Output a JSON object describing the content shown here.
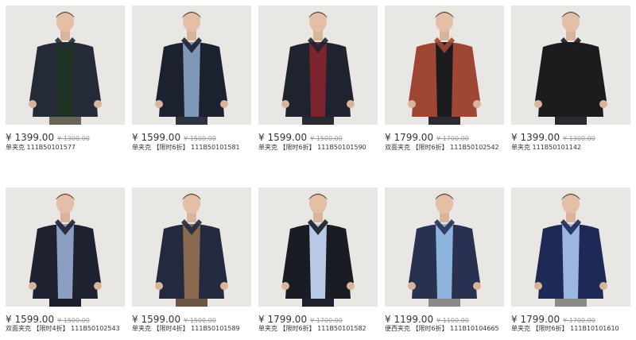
{
  "colors": {
    "photo_bg": "#e9e7e4",
    "text": "#333333",
    "strike": "#999999"
  },
  "products": [
    {
      "price": "¥ 1399.00",
      "old_price": "¥ 1300.00",
      "title": "单夹克 111B50101577",
      "image": {
        "icon": "jacket-model-photo",
        "jacket": "#252a37",
        "inner": "#1f3324",
        "pants": "#6b6558"
      }
    },
    {
      "price": "¥ 1599.00",
      "old_price": "¥ 1500.00",
      "title": "单夹克 【限时6折】 111B50101581",
      "image": {
        "icon": "jacket-model-photo",
        "jacket": "#1c2130",
        "inner": "#7f98b8",
        "pants": "#2d3140"
      }
    },
    {
      "price": "¥ 1599.00",
      "old_price": "¥ 1500.00",
      "title": "单夹克 【限时6折】 111B50101590",
      "image": {
        "icon": "jacket-model-photo",
        "jacket": "#1f232e",
        "inner": "#7b2430",
        "pants": "#2a2a30"
      }
    },
    {
      "price": "¥ 1799.00",
      "old_price": "¥ 1700.00",
      "title": "双面夹克 【限时6折】 111B50102542",
      "image": {
        "icon": "jacket-model-photo",
        "jacket": "#a04634",
        "inner": "#1c1c1f",
        "pants": "#2a2a2e"
      }
    },
    {
      "price": "¥ 1399.00",
      "old_price": "¥ 1300.00",
      "title": "单夹克 111B50101142",
      "image": {
        "icon": "jacket-model-photo",
        "jacket": "#1c1c1f",
        "inner": "#1c1c1f",
        "pants": "#2a2a2e"
      }
    },
    {
      "price": "¥ 1599.00",
      "old_price": "¥ 1500.00",
      "title": "双面夹克 【限时4折】 111B50102543",
      "image": {
        "icon": "jacket-model-photo",
        "jacket": "#1d2130",
        "inner": "#8b9fc0",
        "pants": "#1c1f2a"
      }
    },
    {
      "price": "¥ 1599.00",
      "old_price": "¥ 1500.00",
      "title": "单夹克 【限时4折】 111B50101589",
      "image": {
        "icon": "jacket-model-photo",
        "jacket": "#232a40",
        "inner": "#8a6a4e",
        "pants": "#6a5644"
      }
    },
    {
      "price": "¥ 1799.00",
      "old_price": "¥ 1700.00",
      "title": "单夹克 【限时6折】 111B50101582",
      "image": {
        "icon": "jacket-model-photo",
        "jacket": "#1a1c24",
        "inner": "#b9c9e6",
        "pants": "#1e2030"
      }
    },
    {
      "price": "¥ 1199.00",
      "old_price": "¥ 1100.00",
      "title": "便西夹克 【限时6折】 111B10104665",
      "image": {
        "icon": "jacket-model-photo",
        "jacket": "#283250",
        "inner": "#8eb4de",
        "pants": "#8a8a8a"
      }
    },
    {
      "price": "¥ 1799.00",
      "old_price": "¥ 1700.00",
      "title": "单夹克 【限时6折】 111B10101610",
      "image": {
        "icon": "jacket-model-photo",
        "jacket": "#1e2a55",
        "inner": "#9bb6e0",
        "pants": "#8a8a8a"
      }
    }
  ]
}
